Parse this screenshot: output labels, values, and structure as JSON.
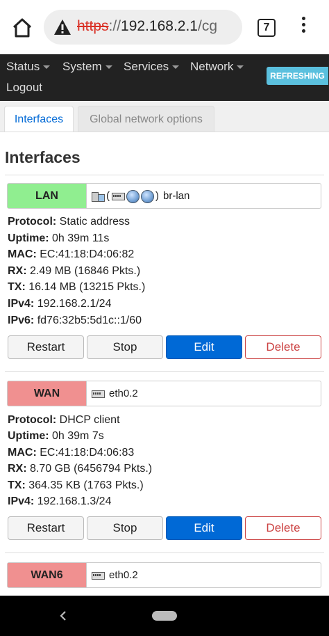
{
  "browser": {
    "url_protocol": "https",
    "url_separator": "://",
    "url_host": "192.168.2.1",
    "url_path": "/cg",
    "tab_count": "7",
    "icons": {
      "home": "home-icon",
      "warning": "warning-icon",
      "menu": "more-vert-icon"
    }
  },
  "header": {
    "nav": [
      "Status",
      "System",
      "Services",
      "Network"
    ],
    "logout": "Logout",
    "indicator": "REFRESHING",
    "indicator_color": "#5bc0de"
  },
  "tabs": {
    "active": "Interfaces",
    "inactive": "Global network options",
    "active_color": "#0069d6"
  },
  "section": {
    "title": "Interfaces"
  },
  "interfaces": [
    {
      "name": "LAN",
      "color": "#90ee90",
      "devices_open": "(",
      "devices_close": ")",
      "device": "br-lan",
      "rows": [
        {
          "label": "Protocol:",
          "value": " Static address"
        },
        {
          "label": "Uptime:",
          "value": " 0h 39m 11s"
        },
        {
          "label": "MAC:",
          "value": " EC:41:18:D4:06:82"
        },
        {
          "label": "RX:",
          "value": " 2.49 MB (16846 Pkts.)"
        },
        {
          "label": "TX:",
          "value": " 16.14 MB (13215 Pkts.)"
        },
        {
          "label": "IPv4:",
          "value": " 192.168.2.1/24"
        },
        {
          "label": "IPv6:",
          "value": " fd76:32b5:5d1c::1/60"
        }
      ]
    },
    {
      "name": "WAN",
      "color": "#f09090",
      "device": "eth0.2",
      "rows": [
        {
          "label": "Protocol:",
          "value": " DHCP client"
        },
        {
          "label": "Uptime:",
          "value": " 0h 39m 7s"
        },
        {
          "label": "MAC:",
          "value": " EC:41:18:D4:06:83"
        },
        {
          "label": "RX:",
          "value": " 8.70 GB (6456794 Pkts.)"
        },
        {
          "label": "TX:",
          "value": " 364.35 KB (1763 Pkts.)"
        },
        {
          "label": "IPv4:",
          "value": " 192.168.1.3/24"
        }
      ]
    },
    {
      "name": "WAN6",
      "color": "#f09090",
      "device": "eth0.2"
    }
  ],
  "buttons": {
    "restart": "Restart",
    "stop": "Stop",
    "edit": "Edit",
    "delete": "Delete"
  }
}
